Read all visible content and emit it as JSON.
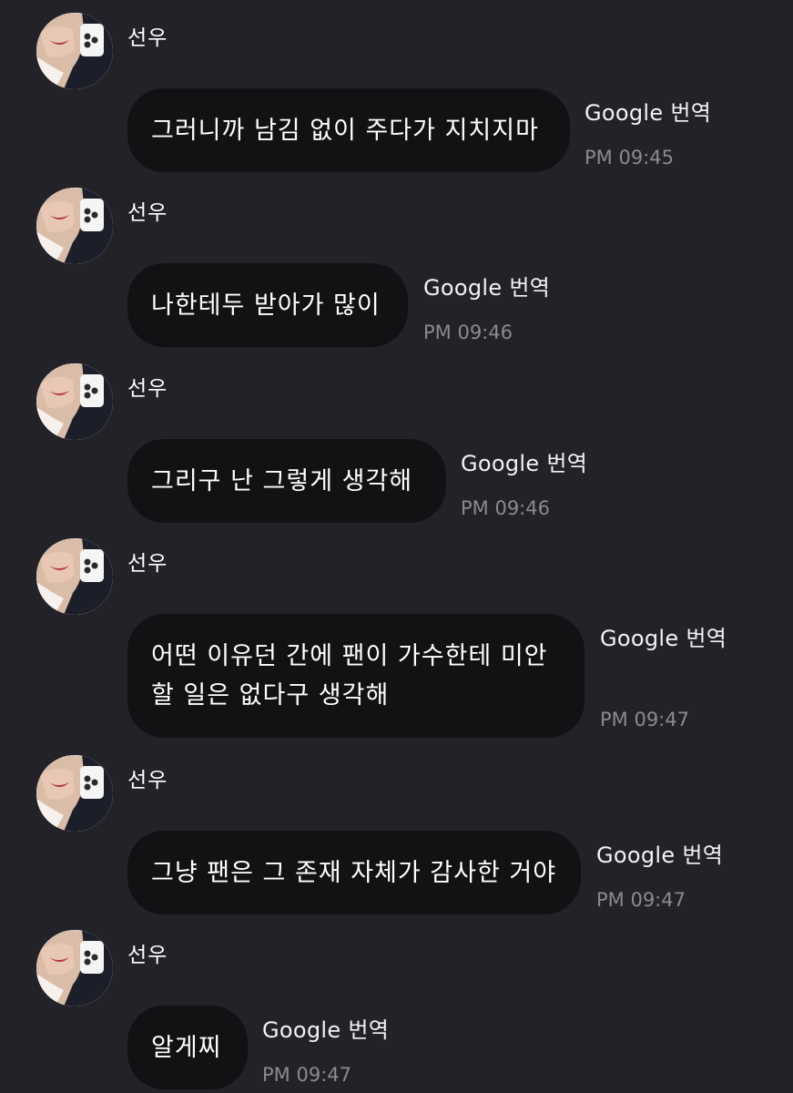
{
  "messages": [
    {
      "sender": "선우",
      "lines": [
        "그러니까 남김 없이 주다가 지치지마"
      ],
      "translate": "Google 번역",
      "time": "PM 09:45"
    },
    {
      "sender": "선우",
      "lines": [
        "나한테두 받아가 많이"
      ],
      "translate": "Google 번역",
      "time": "PM 09:46"
    },
    {
      "sender": "선우",
      "lines": [
        "그리구 난 그렇게 생각해"
      ],
      "translate": "Google 번역",
      "time": "PM 09:46"
    },
    {
      "sender": "선우",
      "lines": [
        "어떤 이유던 간에 팬이 가수한테 미안",
        "할 일은 없다구 생각해"
      ],
      "translate": "Google 번역",
      "time": "PM 09:47"
    },
    {
      "sender": "선우",
      "lines": [
        "그냥 팬은 그 존재 자체가 감사한 거야"
      ],
      "translate": "Google 번역",
      "time": "PM 09:47"
    },
    {
      "sender": "선우",
      "lines": [
        "알게찌"
      ],
      "translate": "Google 번역",
      "time": "PM 09:47"
    }
  ],
  "colors": {
    "background": "#232229",
    "bubble": "#121214",
    "text": "#ffffff",
    "time": "#8b8a90"
  },
  "icons": {
    "avatar": "profile-photo"
  }
}
